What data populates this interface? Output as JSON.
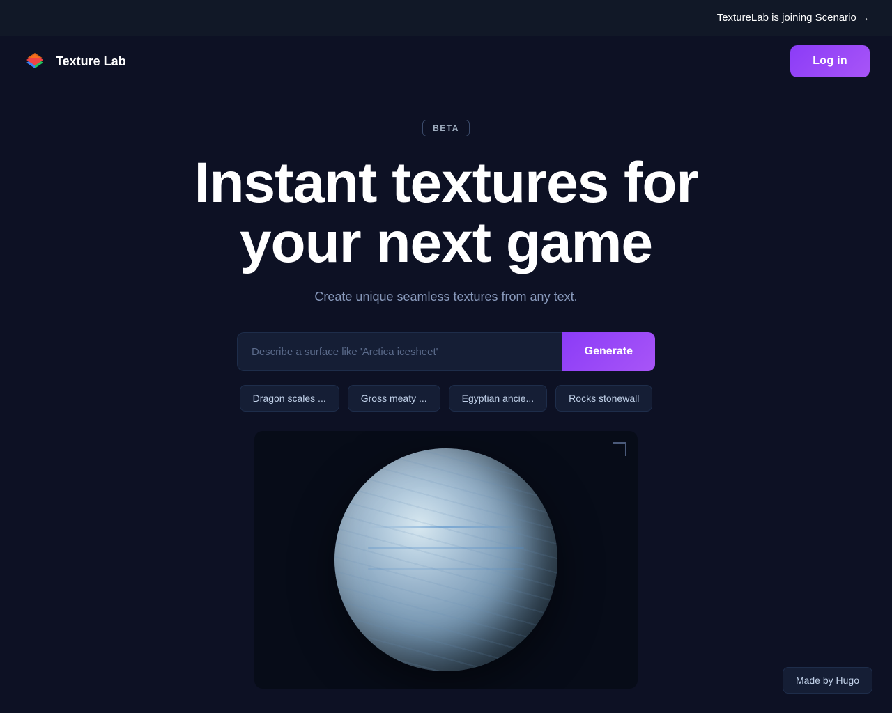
{
  "announcement": {
    "text": "TextureLab is joining Scenario →",
    "arrow": "→"
  },
  "navbar": {
    "logo_text": "Texture Lab",
    "login_label": "Log in"
  },
  "hero": {
    "beta_label": "BETA",
    "title_line1": "Instant textures for",
    "title_line2": "your next game",
    "subtitle": "Create unique seamless textures from any text.",
    "input_placeholder": "Describe a surface like 'Arctica icesheet'",
    "generate_label": "Generate"
  },
  "chips": [
    {
      "label": "Dragon scales ..."
    },
    {
      "label": "Gross meaty ..."
    },
    {
      "label": "Egyptian ancie..."
    },
    {
      "label": "Rocks stonewall"
    }
  ],
  "footer": {
    "made_by": "Made by Hugo"
  }
}
